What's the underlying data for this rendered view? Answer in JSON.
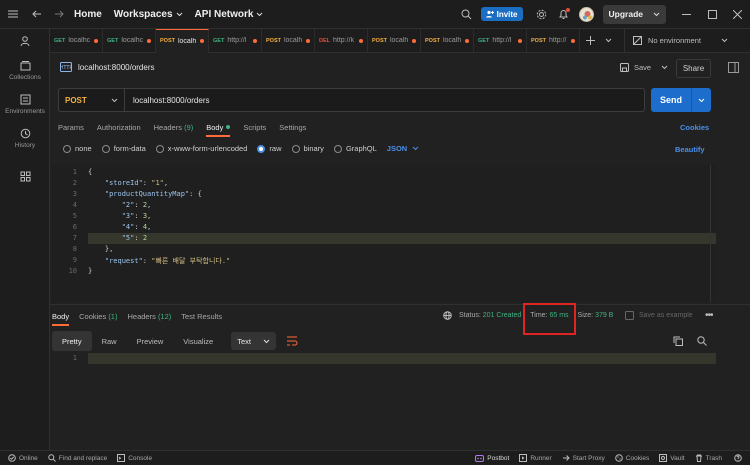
{
  "header": {
    "home": "Home",
    "workspaces": "Workspaces",
    "api_network": "API Network",
    "invite": "Invite",
    "upgrade": "Upgrade"
  },
  "tabs": [
    {
      "method": "GET",
      "label": "localhc",
      "method_color": "#3fb27f",
      "dot": true
    },
    {
      "method": "GET",
      "label": "localhc",
      "method_color": "#3fb27f",
      "dot": true
    },
    {
      "method": "POST",
      "label": "localh",
      "method_color": "#f5b041",
      "dot": true,
      "active": true
    },
    {
      "method": "GET",
      "label": "http://l",
      "method_color": "#3fb27f",
      "dot": true
    },
    {
      "method": "POST",
      "label": "localh",
      "method_color": "#f5b041",
      "dot": true
    },
    {
      "method": "DEL",
      "label": "http://k",
      "method_color": "#e74c3c",
      "dot": true
    },
    {
      "method": "POST",
      "label": "localh",
      "method_color": "#f5b041",
      "dot": true
    },
    {
      "method": "POST",
      "label": "localh",
      "method_color": "#f5b041",
      "dot": true
    },
    {
      "method": "GET",
      "label": "http://l",
      "method_color": "#3fb27f",
      "dot": true
    },
    {
      "method": "POST",
      "label": "http://",
      "method_color": "#f5b041",
      "dot": true
    }
  ],
  "environment": "No environment",
  "sidebar": {
    "items": [
      {
        "label": "",
        "icon": "user-icon"
      },
      {
        "label": "Collections",
        "icon": "collections-icon"
      },
      {
        "label": "Environments",
        "icon": "environments-icon"
      },
      {
        "label": "History",
        "icon": "history-icon"
      },
      {
        "label": "",
        "icon": "apps-icon"
      }
    ]
  },
  "request": {
    "title": "localhost:8000/orders",
    "save": "Save",
    "share": "Share",
    "method": "POST",
    "url": "localhost:8000/orders",
    "send": "Send",
    "tabs": [
      "Params",
      "Authorization",
      "Headers",
      "Body",
      "Scripts",
      "Settings"
    ],
    "headers_count": "(9)",
    "cookies": "Cookies",
    "body_options": [
      "none",
      "form-data",
      "x-www-form-urlencoded",
      "raw",
      "binary",
      "GraphQL"
    ],
    "body_format": "JSON",
    "beautify": "Beautify"
  },
  "editor": {
    "lines": [
      {
        "n": "1",
        "text": "{"
      },
      {
        "n": "2",
        "text": "    \"storeId\": \"1\","
      },
      {
        "n": "3",
        "text": "    \"productQuantityMap\": {"
      },
      {
        "n": "4",
        "text": "        \"2\": 2,"
      },
      {
        "n": "5",
        "text": "        \"3\": 3,"
      },
      {
        "n": "6",
        "text": "        \"4\": 4,"
      },
      {
        "n": "7",
        "text": "        \"5\": 2"
      },
      {
        "n": "8",
        "text": "    },"
      },
      {
        "n": "9",
        "text": "    \"request\": \"빠른 배달 부탁합니다.\""
      },
      {
        "n": "10",
        "text": "}"
      }
    ]
  },
  "response": {
    "tabs": [
      "Body",
      "Cookies",
      "Headers",
      "Test Results"
    ],
    "cookies_count": "(1)",
    "headers_count": "(12)",
    "status_label": "Status:",
    "status_value": "201 Created",
    "time_label": "Time:",
    "time_value": "65 ms",
    "size_label": "Size:",
    "size_value": "379 B",
    "save_example": "Save as example",
    "views": [
      "Pretty",
      "Raw",
      "Preview",
      "Visualize"
    ],
    "format": "Text",
    "line1": "1"
  },
  "statusbar": {
    "online": "Online",
    "find": "Find and replace",
    "console": "Console",
    "postbot": "Postbot",
    "runner": "Runner",
    "proxy": "Start Proxy",
    "cookies": "Cookies",
    "vault": "Vault",
    "trash": "Trash"
  },
  "colors": {
    "accent": "#ff6c37",
    "send": "#1d6ecc",
    "highlight_box": "#e02424"
  }
}
